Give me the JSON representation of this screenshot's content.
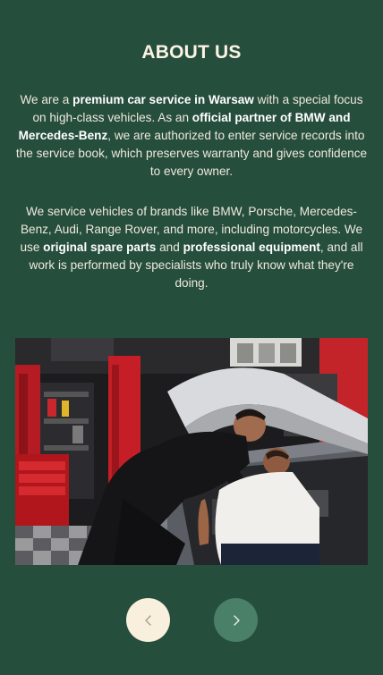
{
  "section": {
    "title": "ABOUT US"
  },
  "paragraph1": {
    "t1": "We are a ",
    "b1": "premium car service in Warsaw",
    "t2": " with a special focus on high-class vehicles. As an ",
    "b2": "official partner of BMW and Mercedes-Benz",
    "t3": ", we are authorized to enter service records into the service book, which preserves warranty and gives confidence to every owner."
  },
  "paragraph2": {
    "t1": "We service vehicles of brands like BMW, Porsche, Mercedes-Benz, Audi, Range Rover, and more, including motorcycles. We use ",
    "b1": "original spare parts",
    "t2": " and ",
    "b2": "professional equipment",
    "t3": ", and all work is performed by specialists who truly know what they're doing."
  },
  "carousel": {
    "prev_icon": "chevron-left-icon",
    "next_icon": "chevron-right-icon"
  },
  "colors": {
    "background": "#264e3d",
    "prev_button": "#f8efdc",
    "next_button": "#4a7f68"
  }
}
